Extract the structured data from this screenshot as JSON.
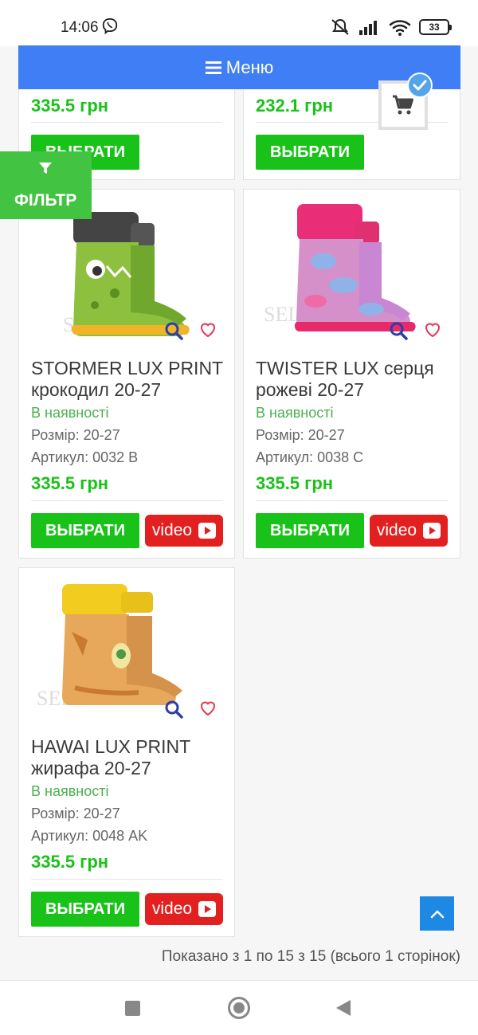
{
  "status_bar": {
    "time": "14:06",
    "battery": "33"
  },
  "menu": {
    "label": "Меню"
  },
  "filter": {
    "label": "ФІЛЬТР"
  },
  "top_cards": [
    {
      "price": "335.5 грн",
      "buy_label": "ВЫБРАТИ"
    },
    {
      "price": "232.1 грн",
      "buy_label": "ВЫБРАТИ"
    }
  ],
  "products": [
    {
      "title": "STORMER LUX PRINT крокодил 20-27",
      "availability": "В наявності",
      "size": "Розмір: 20-27",
      "sku": "Артикул: 0032 B",
      "price": "335.5 грн",
      "buy_label": "ВЫБРАТИ",
      "video_label": "video"
    },
    {
      "title": "TWISTER LUX серця рожеві 20-27",
      "availability": "В наявності",
      "size": "Розмір: 20-27",
      "sku": "Артикул: 0038 C",
      "price": "335.5 грн",
      "buy_label": "ВЫБРАТИ",
      "video_label": "video"
    },
    {
      "title": "HAWAI LUX PRINT жирафа 20-27",
      "availability": "В наявності",
      "size": "Розмір: 20-27",
      "sku": "Артикул: 0048 AK",
      "price": "335.5 грн",
      "buy_label": "ВЫБРАТИ",
      "video_label": "video"
    }
  ],
  "pagination": {
    "text": "Показано з 1 по 15 з 15 (всього 1 сторінок)"
  },
  "colors": {
    "accent_blue": "#3f7ef4",
    "green": "#19c219",
    "video_red": "#e32020",
    "filter_green": "#42c442"
  },
  "icons": [
    "viber-icon",
    "mute-icon",
    "signal-icon",
    "wifi-icon",
    "battery-icon",
    "menu-icon",
    "filter-icon",
    "cart-icon",
    "check-icon",
    "zoom-icon",
    "heart-icon",
    "play-icon",
    "arrow-up-icon",
    "nav-square-icon",
    "nav-home-icon",
    "nav-back-icon"
  ]
}
